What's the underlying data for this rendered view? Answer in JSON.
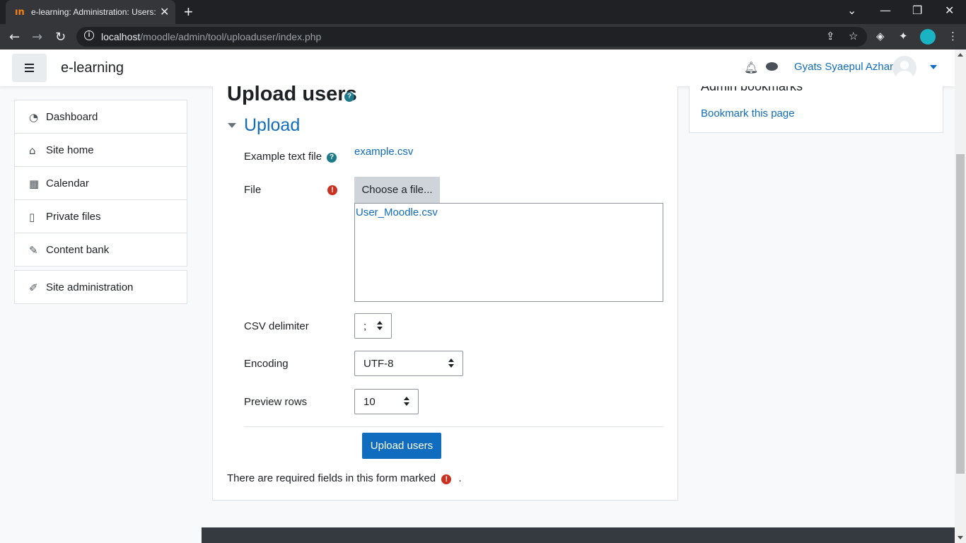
{
  "browser": {
    "tab_title": "e-learning: Administration: Users: Accounts: Upload users",
    "favicon": "moodle-icon",
    "url_host": "localhost",
    "url_path": "/moodle/admin/tool/uploaduser/index.php"
  },
  "navbar": {
    "brand": "e-learning",
    "user_name": "Gyats Syaepul Azhar"
  },
  "sidebar": {
    "items": [
      {
        "label": "Dashboard",
        "icon": "dashboard-icon"
      },
      {
        "label": "Site home",
        "icon": "home-icon"
      },
      {
        "label": "Calendar",
        "icon": "calendar-icon"
      },
      {
        "label": "Private files",
        "icon": "file-icon"
      },
      {
        "label": "Content bank",
        "icon": "paintbrush-icon"
      }
    ],
    "admin": {
      "label": "Site administration",
      "icon": "wrench-icon"
    }
  },
  "main": {
    "page_title": "Upload users",
    "section_title": "Upload",
    "example_label": "Example text file",
    "example_link": "example.csv",
    "file_label": "File",
    "choose_button": "Choose a file...",
    "selected_file": "User_Moodle.csv",
    "csv_label": "CSV delimiter",
    "csv_value": ";",
    "encoding_label": "Encoding",
    "encoding_value": "UTF-8",
    "preview_label": "Preview rows",
    "preview_value": "10",
    "submit_button": "Upload users",
    "required_note": "There are required fields in this form marked",
    "required_note_end": "."
  },
  "right_block": {
    "title": "Admin bookmarks",
    "link": "Bookmark this page"
  },
  "colors": {
    "brand_blue": "#0f6cbf",
    "required_red": "#ca3120",
    "help_teal": "#1d7a8a"
  }
}
